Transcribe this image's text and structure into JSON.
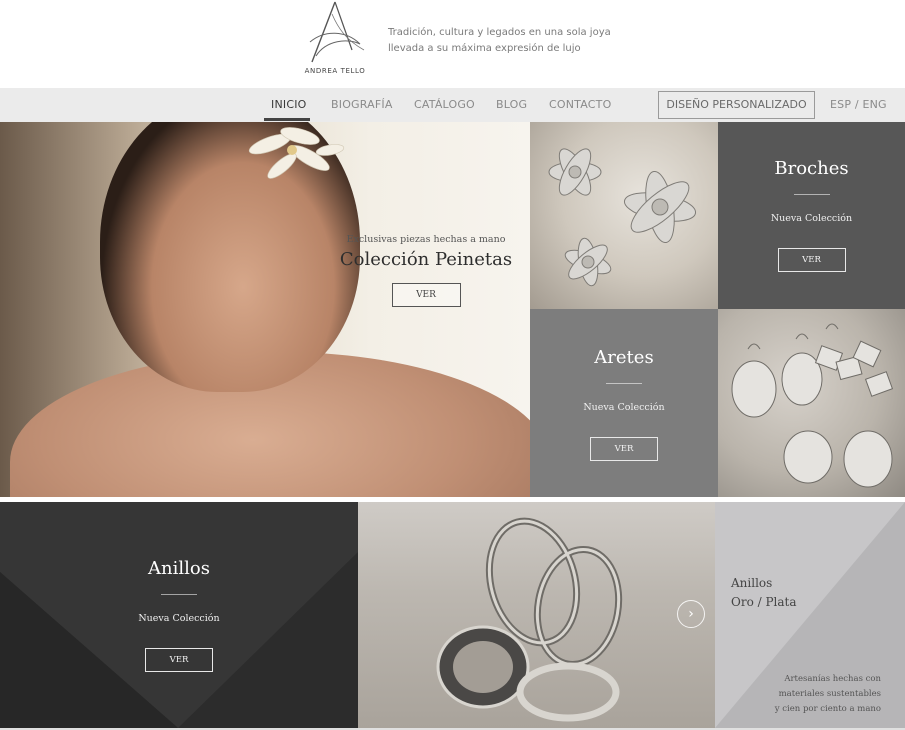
{
  "header": {
    "brand": "ANDREA TELLO",
    "tagline_line1": "Tradición, cultura y legados en una sola joya",
    "tagline_line2": "llevada a su máxima expresión de lujo"
  },
  "nav": {
    "items": [
      {
        "label": "INICIO",
        "active": true
      },
      {
        "label": "BIOGRAFÍA",
        "active": false
      },
      {
        "label": "CATÁLOGO",
        "active": false
      },
      {
        "label": "BLOG",
        "active": false
      },
      {
        "label": "CONTACTO",
        "active": false
      }
    ],
    "cta_label": "DISEÑO PERSONALIZADO",
    "language_label": "ESP / ENG"
  },
  "hero": {
    "subtitle": "Exclusivas piezas hechas a mano",
    "title": "Colección Peinetas",
    "button": "VER"
  },
  "broches": {
    "title": "Broches",
    "subtitle": "Nueva Colección",
    "button": "VER"
  },
  "aretes": {
    "title": "Aretes",
    "subtitle": "Nueva Colección",
    "button": "VER"
  },
  "anillos": {
    "title": "Anillos",
    "subtitle": "Nueva Colección",
    "button": "VER"
  },
  "anillos_side": {
    "title_line1": "Anillos",
    "title_line2": "Oro / Plata",
    "note_line1": "Artesanías hechas con",
    "note_line2": "materiales sustentables",
    "note_line3": "y cien por ciento a mano"
  },
  "icons": {
    "slider_next": "chevron-right-icon"
  },
  "colors": {
    "nav_bg": "#ebebeb",
    "panel_dark": "#575757",
    "panel_mid": "#7d7d7d",
    "panel_black": "#2c2c2c",
    "panel_light": "#b6b5b7"
  }
}
